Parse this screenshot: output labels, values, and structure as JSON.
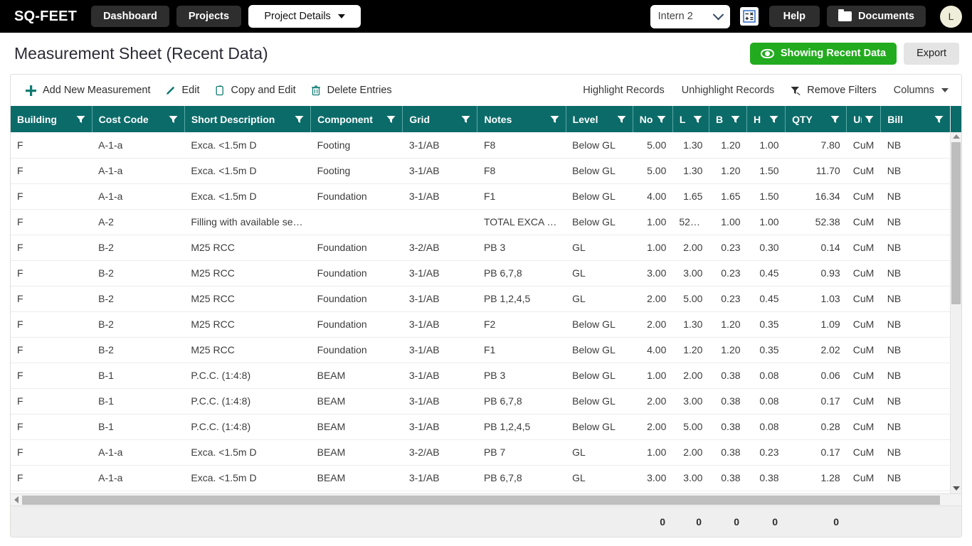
{
  "navbar": {
    "brand": "SQ-FEET",
    "buttons": [
      {
        "label": "Dashboard",
        "name": "dashboard"
      },
      {
        "label": "Projects",
        "name": "projects"
      }
    ],
    "project_details": {
      "label": "Project Details",
      "icon": "caret-down-icon"
    },
    "intern_select": {
      "value": "Intern 2",
      "icon": "chevron-down-icon"
    },
    "calculator_icon": "calculator-icon",
    "help_label": "Help",
    "documents": {
      "label": "Documents",
      "icon": "folder-icon"
    },
    "avatar_initial": "L",
    "background": "#000000"
  },
  "header": {
    "title": "Measurement Sheet (Recent Data)",
    "showing_recent": {
      "label": "Showing Recent Data",
      "icon": "eye-icon",
      "color": "#22ab1e"
    },
    "export_label": "Export"
  },
  "toolbar": {
    "left": [
      {
        "label": "Add New Measurement",
        "icon": "plus-icon",
        "name": "add-new-measurement"
      },
      {
        "label": "Edit",
        "icon": "pencil-icon",
        "name": "edit"
      },
      {
        "label": "Copy and Edit",
        "icon": "copy-icon",
        "name": "copy-and-edit"
      },
      {
        "label": "Delete Entries",
        "icon": "trash-icon",
        "name": "delete-entries"
      }
    ],
    "right": [
      {
        "label": "Highlight Records",
        "name": "highlight-records"
      },
      {
        "label": "Unhighlight Records",
        "name": "unhighlight-records"
      },
      {
        "label": "Remove Filters",
        "icon": "filter-remove-icon",
        "name": "remove-filters"
      }
    ],
    "columns": {
      "label": "Columns",
      "icon": "caret-down-icon"
    },
    "accent": "#0f7a72"
  },
  "table": {
    "header_color": "#0b6b69",
    "selected_row_color": "#c9fbf6",
    "columns": [
      {
        "key": "building",
        "label": "Building",
        "align": "left",
        "filter": true
      },
      {
        "key": "cost_code",
        "label": "Cost Code",
        "align": "left",
        "filter": true
      },
      {
        "key": "short_desc",
        "label": "Short Description",
        "align": "left",
        "filter": true
      },
      {
        "key": "component",
        "label": "Component",
        "align": "left",
        "filter": true
      },
      {
        "key": "grid",
        "label": "Grid",
        "align": "left",
        "filter": true
      },
      {
        "key": "notes",
        "label": "Notes",
        "align": "left",
        "filter": true
      },
      {
        "key": "level",
        "label": "Level",
        "align": "left",
        "filter": true
      },
      {
        "key": "no",
        "label": "No",
        "align": "right",
        "filter": true
      },
      {
        "key": "l",
        "label": "L",
        "align": "right",
        "filter": true
      },
      {
        "key": "b",
        "label": "B",
        "align": "right",
        "filter": true
      },
      {
        "key": "h",
        "label": "H",
        "align": "right",
        "filter": true
      },
      {
        "key": "qty",
        "label": "QTY",
        "align": "right",
        "filter": true
      },
      {
        "key": "unit",
        "label": "Unit",
        "align": "left",
        "filter": true
      },
      {
        "key": "bill",
        "label": "Bill",
        "align": "left",
        "filter": true
      }
    ],
    "rows": [
      {
        "selected": true,
        "building": "F",
        "cost_code": "A-1-a",
        "short_desc": "Exca. <1.5m D",
        "component": "Footing",
        "grid": "3-1/AB",
        "notes": "F8",
        "level": "Below GL",
        "no": "5.00",
        "l": "1.30",
        "b": "1.20",
        "h": "1.00",
        "qty": "7.80",
        "unit": "CuM",
        "bill": "NB"
      },
      {
        "selected": false,
        "building": "F",
        "cost_code": "A-1-a",
        "short_desc": "Exca. <1.5m D",
        "component": "Footing",
        "grid": "3-1/AB",
        "notes": "F8",
        "level": "Below GL",
        "no": "5.00",
        "l": "1.30",
        "b": "1.20",
        "h": "1.50",
        "qty": "11.70",
        "unit": "CuM",
        "bill": "NB"
      },
      {
        "selected": false,
        "building": "F",
        "cost_code": "A-1-a",
        "short_desc": "Exca. <1.5m D",
        "component": "Foundation",
        "grid": "3-1/AB",
        "notes": "F1",
        "level": "Below GL",
        "no": "4.00",
        "l": "1.65",
        "b": "1.65",
        "h": "1.50",
        "qty": "16.34",
        "unit": "CuM",
        "bill": "NB"
      },
      {
        "selected": false,
        "building": "F",
        "cost_code": "A-2",
        "short_desc": "Filling with available sel…",
        "component": "",
        "grid": "",
        "notes": "TOTAL EXCA …",
        "level": "Below GL",
        "no": "1.00",
        "l": "52.…",
        "b": "1.00",
        "h": "1.00",
        "qty": "52.38",
        "unit": "CuM",
        "bill": "NB"
      },
      {
        "selected": false,
        "building": "F",
        "cost_code": "B-2",
        "short_desc": "M25 RCC",
        "component": "Foundation",
        "grid": "3-2/AB",
        "notes": "PB 3",
        "level": "GL",
        "no": "1.00",
        "l": "2.00",
        "b": "0.23",
        "h": "0.30",
        "qty": "0.14",
        "unit": "CuM",
        "bill": "NB"
      },
      {
        "selected": false,
        "building": "F",
        "cost_code": "B-2",
        "short_desc": "M25 RCC",
        "component": "Foundation",
        "grid": "3-1/AB",
        "notes": "PB 6,7,8",
        "level": "GL",
        "no": "3.00",
        "l": "3.00",
        "b": "0.23",
        "h": "0.45",
        "qty": "0.93",
        "unit": "CuM",
        "bill": "NB"
      },
      {
        "selected": false,
        "building": "F",
        "cost_code": "B-2",
        "short_desc": "M25 RCC",
        "component": "Foundation",
        "grid": "3-1/AB",
        "notes": "PB 1,2,4,5",
        "level": "GL",
        "no": "2.00",
        "l": "5.00",
        "b": "0.23",
        "h": "0.45",
        "qty": "1.03",
        "unit": "CuM",
        "bill": "NB"
      },
      {
        "selected": false,
        "building": "F",
        "cost_code": "B-2",
        "short_desc": "M25 RCC",
        "component": "Foundation",
        "grid": "3-1/AB",
        "notes": "F2",
        "level": "Below GL",
        "no": "2.00",
        "l": "1.30",
        "b": "1.20",
        "h": "0.35",
        "qty": "1.09",
        "unit": "CuM",
        "bill": "NB"
      },
      {
        "selected": false,
        "building": "F",
        "cost_code": "B-2",
        "short_desc": "M25 RCC",
        "component": "Foundation",
        "grid": "3-1/AB",
        "notes": "F1",
        "level": "Below GL",
        "no": "4.00",
        "l": "1.20",
        "b": "1.20",
        "h": "0.35",
        "qty": "2.02",
        "unit": "CuM",
        "bill": "NB"
      },
      {
        "selected": false,
        "building": "F",
        "cost_code": "B-1",
        "short_desc": "P.C.C. (1:4:8)",
        "component": "BEAM",
        "grid": "3-1/AB",
        "notes": "PB 3",
        "level": "Below GL",
        "no": "1.00",
        "l": "2.00",
        "b": "0.38",
        "h": "0.08",
        "qty": "0.06",
        "unit": "CuM",
        "bill": "NB"
      },
      {
        "selected": false,
        "building": "F",
        "cost_code": "B-1",
        "short_desc": "P.C.C. (1:4:8)",
        "component": "BEAM",
        "grid": "3-1/AB",
        "notes": "PB 6,7,8",
        "level": "Below GL",
        "no": "2.00",
        "l": "3.00",
        "b": "0.38",
        "h": "0.08",
        "qty": "0.17",
        "unit": "CuM",
        "bill": "NB"
      },
      {
        "selected": false,
        "building": "F",
        "cost_code": "B-1",
        "short_desc": "P.C.C. (1:4:8)",
        "component": "BEAM",
        "grid": "3-1/AB",
        "notes": "PB 1,2,4,5",
        "level": "Below GL",
        "no": "2.00",
        "l": "5.00",
        "b": "0.38",
        "h": "0.08",
        "qty": "0.28",
        "unit": "CuM",
        "bill": "NB"
      },
      {
        "selected": false,
        "building": "F",
        "cost_code": "A-1-a",
        "short_desc": "Exca. <1.5m D",
        "component": "BEAM",
        "grid": "3-2/AB",
        "notes": "PB 7",
        "level": "GL",
        "no": "1.00",
        "l": "2.00",
        "b": "0.38",
        "h": "0.23",
        "qty": "0.17",
        "unit": "CuM",
        "bill": "NB"
      },
      {
        "selected": false,
        "building": "F",
        "cost_code": "A-1-a",
        "short_desc": "Exca. <1.5m D",
        "component": "BEAM",
        "grid": "3-1/AB",
        "notes": "PB 6,7,8",
        "level": "GL",
        "no": "3.00",
        "l": "3.00",
        "b": "0.38",
        "h": "0.38",
        "qty": "1.28",
        "unit": "CuM",
        "bill": "NB"
      }
    ],
    "footer_totals": {
      "no": "0",
      "l": "0",
      "b": "0",
      "h": "0",
      "qty": "0"
    }
  }
}
